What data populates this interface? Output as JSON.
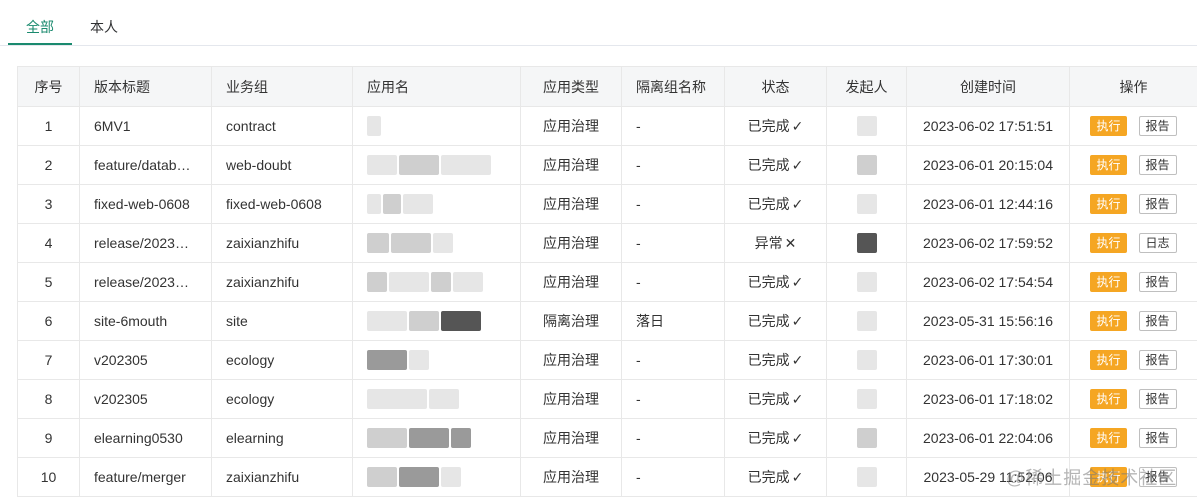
{
  "tabs": [
    {
      "label": "全部",
      "active": true
    },
    {
      "label": "本人",
      "active": false
    }
  ],
  "colors": {
    "accent": "#1a8a6e",
    "exec_button": "#f5a623"
  },
  "table": {
    "headers": [
      "序号",
      "版本标题",
      "业务组",
      "应用名",
      "应用类型",
      "隔离组名称",
      "状态",
      "发起人",
      "创建时间",
      "操作"
    ],
    "rows": [
      {
        "no": "1",
        "title": "6MV1",
        "group": "contract",
        "type": "应用治理",
        "isolation": "-",
        "status": "已完成",
        "status_icon": "check-icon",
        "created": "2023-06-02 17:51:51",
        "exec": "执行",
        "action2": "报告"
      },
      {
        "no": "2",
        "title": "feature/datab…",
        "group": "web-doubt",
        "type": "应用治理",
        "isolation": "-",
        "status": "已完成",
        "status_icon": "check-icon",
        "created": "2023-06-01 20:15:04",
        "exec": "执行",
        "action2": "报告"
      },
      {
        "no": "3",
        "title": "fixed-web-0608",
        "group": "fixed-web-0608",
        "type": "应用治理",
        "isolation": "-",
        "status": "已完成",
        "status_icon": "check-icon",
        "created": "2023-06-01 12:44:16",
        "exec": "执行",
        "action2": "报告"
      },
      {
        "no": "4",
        "title": "release/2023…",
        "group": "zaixianzhifu",
        "type": "应用治理",
        "isolation": "-",
        "status": "异常",
        "status_icon": "cross-icon",
        "created": "2023-06-02 17:59:52",
        "exec": "执行",
        "action2": "日志"
      },
      {
        "no": "5",
        "title": "release/2023…",
        "group": "zaixianzhifu",
        "type": "应用治理",
        "isolation": "-",
        "status": "已完成",
        "status_icon": "check-icon",
        "created": "2023-06-02 17:54:54",
        "exec": "执行",
        "action2": "报告"
      },
      {
        "no": "6",
        "title": "site-6mouth",
        "group": "site",
        "type": "隔离治理",
        "isolation": "落日",
        "status": "已完成",
        "status_icon": "check-icon",
        "created": "2023-05-31 15:56:16",
        "exec": "执行",
        "action2": "报告"
      },
      {
        "no": "7",
        "title": "v202305",
        "group": "ecology",
        "type": "应用治理",
        "isolation": "-",
        "status": "已完成",
        "status_icon": "check-icon",
        "created": "2023-06-01 17:30:01",
        "exec": "执行",
        "action2": "报告"
      },
      {
        "no": "8",
        "title": "v202305",
        "group": "ecology",
        "type": "应用治理",
        "isolation": "-",
        "status": "已完成",
        "status_icon": "check-icon",
        "created": "2023-06-01 17:18:02",
        "exec": "执行",
        "action2": "报告"
      },
      {
        "no": "9",
        "title": "elearning0530",
        "group": "elearning",
        "type": "应用治理",
        "isolation": "-",
        "status": "已完成",
        "status_icon": "check-icon",
        "created": "2023-06-01 22:04:06",
        "exec": "执行",
        "action2": "报告"
      },
      {
        "no": "10",
        "title": "feature/merger",
        "group": "zaixianzhifu",
        "type": "应用治理",
        "isolation": "-",
        "status": "已完成",
        "status_icon": "check-icon",
        "created": "2023-05-29 11:52:06",
        "exec": "执行",
        "action2": "报告"
      }
    ]
  },
  "watermark": "@稀土掘金技术社区"
}
